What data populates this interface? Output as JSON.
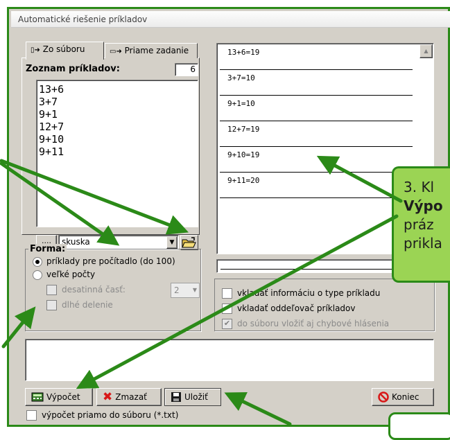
{
  "window": {
    "title": "Automatické riešenie príkladov"
  },
  "tabs": [
    {
      "label": "Zo súboru",
      "active": true
    },
    {
      "label": "Priame zadanie",
      "active": false
    }
  ],
  "examples": {
    "label": "Zoznam príkladov:",
    "count": "6",
    "items": [
      "13+6",
      "3+7",
      "9+1",
      "12+7",
      "9+10",
      "9+11"
    ],
    "browse_label": "....",
    "file_value": "skuska"
  },
  "results": [
    "13+6=19",
    "3+7=10",
    "9+1=10",
    "12+7=19",
    "9+10=19",
    "9+11=20"
  ],
  "forma": {
    "label": "Forma:",
    "option1": "príklady pre počítadlo (do 100)",
    "option2": "veľké počty",
    "decimal_label": "desatinná časť:",
    "decimal_value": "2",
    "long_division": "dlhé delenie"
  },
  "options": {
    "info": "vkladať informáciu o type príkladu",
    "separator": "vkladať oddeľovač príkladov",
    "errors": "do súboru vložiť aj chybové hlásenia"
  },
  "buttons": {
    "compute": "Výpočet",
    "clear": "Zmazať",
    "save": "Uložiť",
    "close": "Koniec"
  },
  "direct_file": "výpočet priamo do súboru (*.txt)",
  "callout": {
    "line1": "3. Kl",
    "line2": "Výpo",
    "line3": "práz",
    "line4": "prikla"
  },
  "colors": {
    "annotation_green": "#2b8a18",
    "callout_fill": "#9bd454"
  }
}
